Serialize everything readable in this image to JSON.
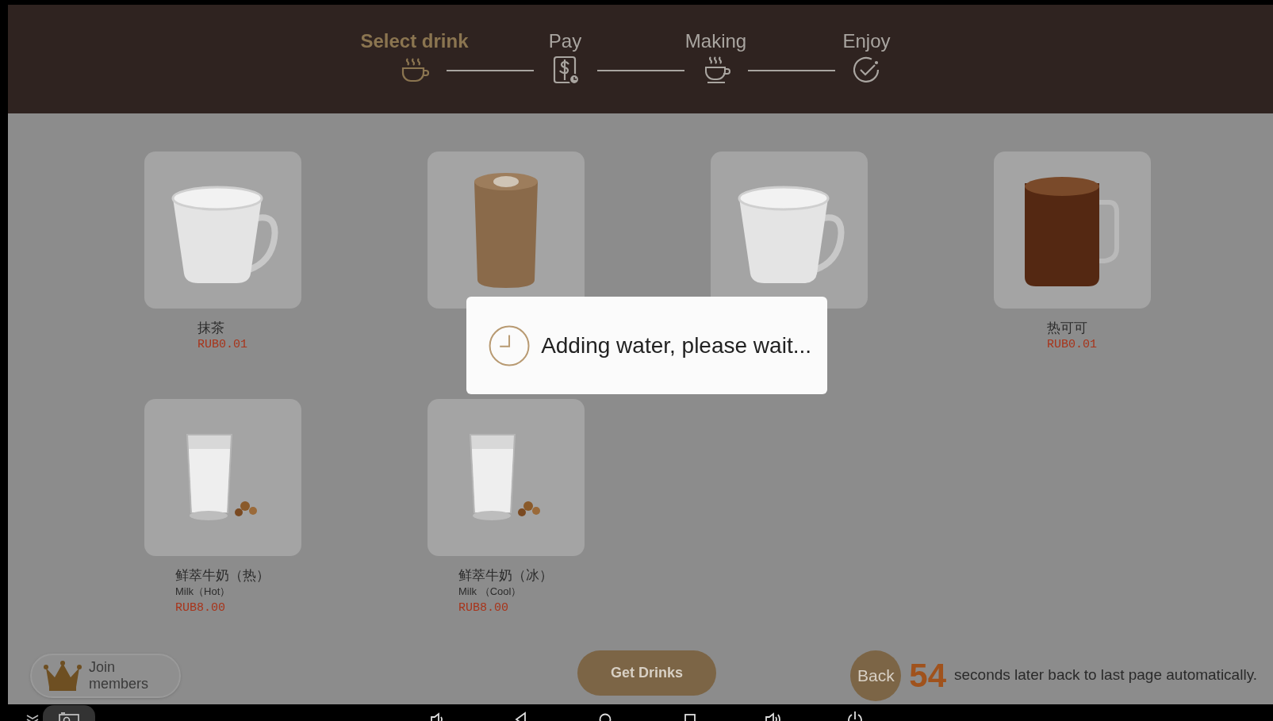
{
  "steps": [
    {
      "label": "Select drink",
      "selected": true
    },
    {
      "label": "Pay",
      "selected": false
    },
    {
      "label": "Making",
      "selected": false
    },
    {
      "label": "Enjoy",
      "selected": false
    }
  ],
  "products": [
    {
      "kind": "mug",
      "name": "抹茶",
      "price": "RUB0.01"
    },
    {
      "kind": "tall-glass"
    },
    {
      "kind": "mug"
    },
    {
      "kind": "glass-mug",
      "name": "热可可",
      "price": "RUB0.01"
    },
    {
      "kind": "milk-glass",
      "name": "鲜萃牛奶（热）",
      "subtitle": "Milk（Hot）",
      "price": "RUB8.00"
    },
    {
      "kind": "milk-glass",
      "name": "鲜萃牛奶（冰）",
      "subtitle": "Milk （Cool）",
      "price": "RUB8.00"
    }
  ],
  "dialog": {
    "message": "Adding water, please wait..."
  },
  "footer": {
    "join_label": "Join members",
    "get_drinks": "Get Drinks",
    "back": "Back",
    "countdown": "54",
    "countdown_text": "seconds later back to last page automatically."
  }
}
